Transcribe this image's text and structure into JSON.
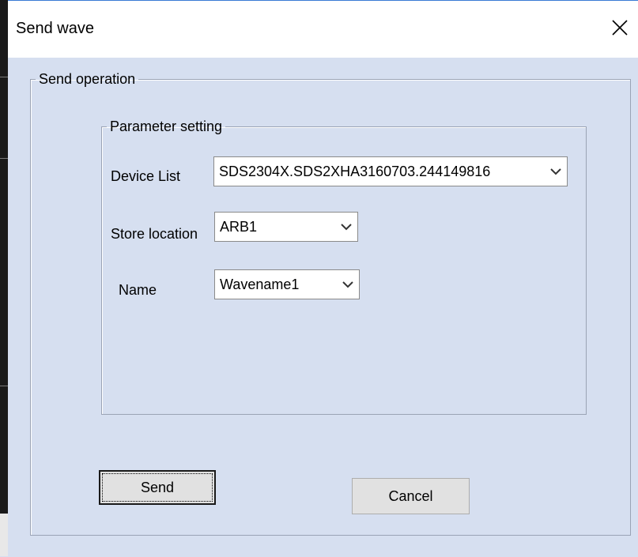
{
  "window": {
    "title": "Send wave"
  },
  "send_operation": {
    "legend": "Send operation",
    "parameter_setting": {
      "legend": "Parameter  setting",
      "device_list": {
        "label": "Device List",
        "value": "SDS2304X.SDS2XHA3160703.244149816"
      },
      "store_location": {
        "label": "Store location",
        "value": "ARB1"
      },
      "name": {
        "label": "Name",
        "value": "Wavename1"
      }
    }
  },
  "buttons": {
    "send": "Send",
    "cancel": "Cancel"
  },
  "colors": {
    "dialog_bg": "#d6dff0",
    "titlebar_bg": "#ffffff",
    "button_bg": "#e1e1e1",
    "accent": "#3a7bd5"
  },
  "icons": {
    "close": "close-icon",
    "dropdown": "chevron-down-icon"
  }
}
